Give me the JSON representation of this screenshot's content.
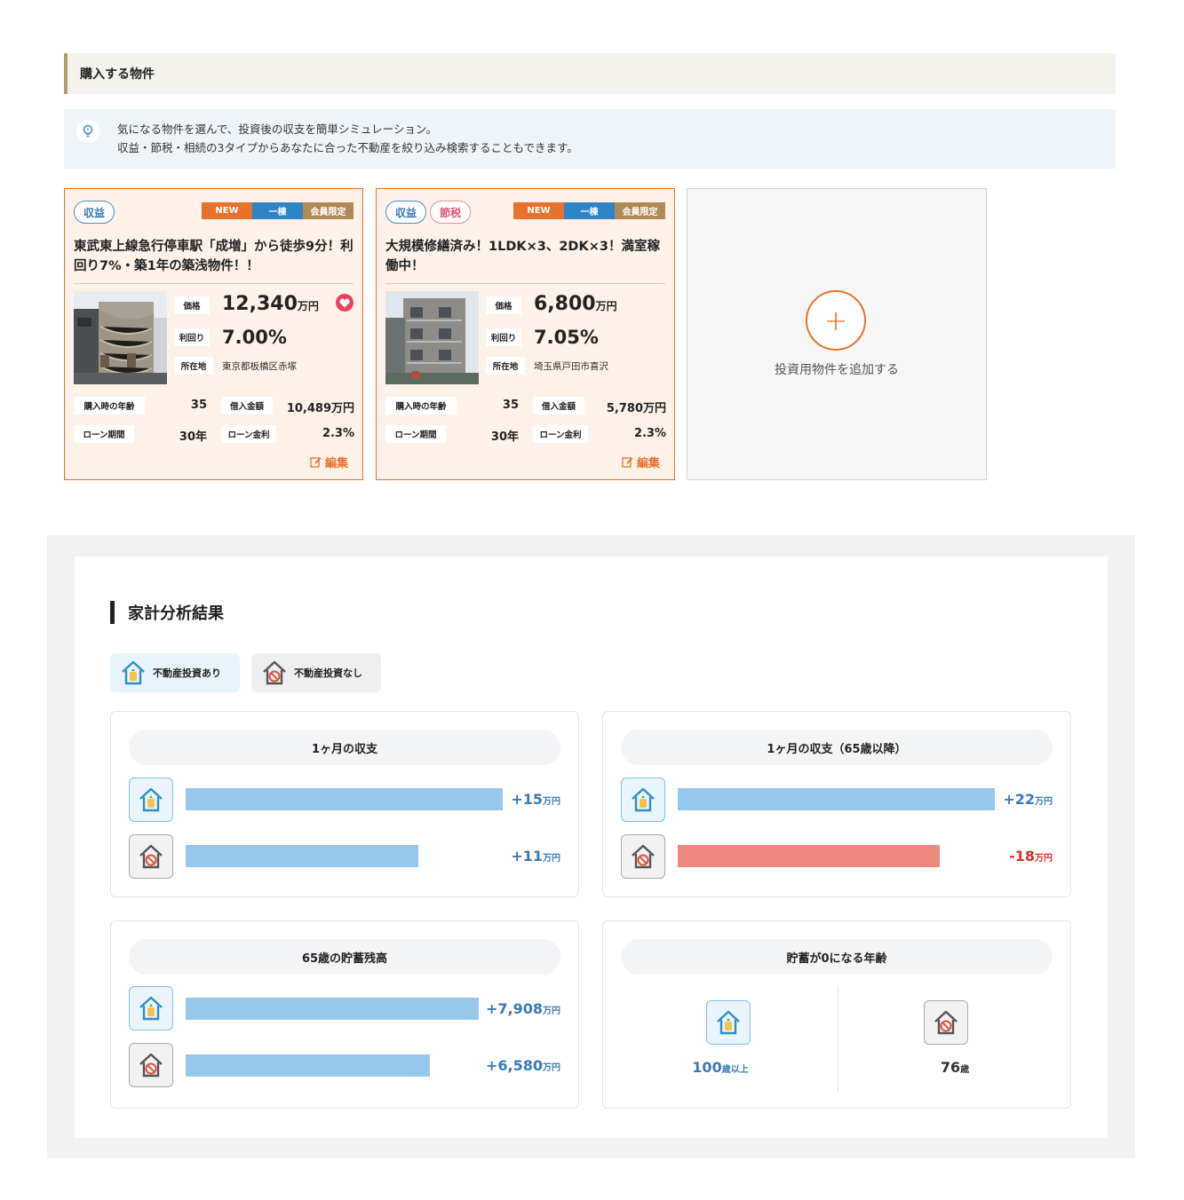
{
  "section": {
    "title": "購入する物件",
    "tip_lines": [
      "気になる物件を選んで、投資後の収支を簡単シミュレーション。",
      "収益・節税・相続の3タイプからあなたに合った不動産を絞り込み検索することもできます。"
    ]
  },
  "properties": [
    {
      "tags": [
        "収益"
      ],
      "badges": [
        "NEW",
        "一棟",
        "会員限定"
      ],
      "title": "東武東上線急行停車駅「成増」から徒歩9分！利回り7%・築1年の築浅物件！！",
      "price_label": "価格",
      "price": "12,340",
      "price_unit": "万円",
      "yield_label": "利回り",
      "yield": "7.00%",
      "loc_label": "所在地",
      "location": "東京都板橋区赤塚",
      "age_label": "購入時の年齢",
      "age": "35",
      "loan_label": "借入金額",
      "loan": "10,489万円",
      "term_label": "ローン期間",
      "term": "30年",
      "rate_label": "ローン金利",
      "rate": "2.3%",
      "edit": "編集"
    },
    {
      "tags": [
        "収益",
        "節税"
      ],
      "badges": [
        "NEW",
        "一棟",
        "会員限定"
      ],
      "title": "大規模修繕済み！1LDK×3、2DK×3！満室稼働中！",
      "price_label": "価格",
      "price": "6,800",
      "price_unit": "万円",
      "yield_label": "利回り",
      "yield": "7.05%",
      "loc_label": "所在地",
      "location": "埼玉県戸田市喜沢",
      "age_label": "購入時の年齢",
      "age": "35",
      "loan_label": "借入金額",
      "loan": "5,780万円",
      "term_label": "ローン期間",
      "term": "30年",
      "rate_label": "ローン金利",
      "rate": "2.3%",
      "edit": "編集"
    }
  ],
  "add_property": {
    "label": "投資用物件を追加する",
    "icon": "plus-icon"
  },
  "analysis": {
    "title": "家計分析結果",
    "legend_with": "不動産投資あり",
    "legend_without": "不動産投資なし",
    "monthly": {
      "title": "1ヶ月の収支",
      "with": "+15",
      "without": "+11",
      "unit": "万円"
    },
    "monthly65": {
      "title": "1ヶ月の収支（65歳以降）",
      "with": "+22",
      "without": "-18",
      "unit": "万円"
    },
    "savings65": {
      "title": "65歳の貯蓄残高",
      "with": "+7,908",
      "without": "+6,580",
      "unit": "万円"
    },
    "zero_age": {
      "title": "貯蓄が0になる年齢",
      "with": "100",
      "with_unit": "歳以上",
      "without": "76",
      "without_unit": "歳"
    }
  },
  "colors": {
    "accent": "#e5732c",
    "positive": "#3a7ab8",
    "negative": "#d4322a",
    "bar_pos": "#94c9ec",
    "bar_neg": "#ee887f"
  }
}
